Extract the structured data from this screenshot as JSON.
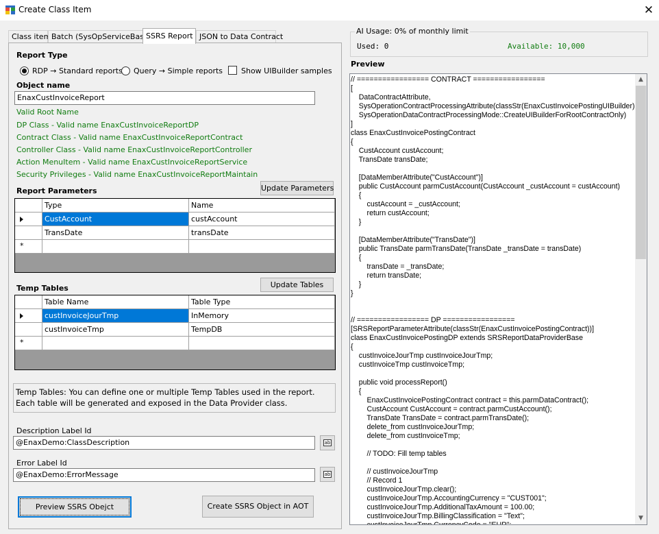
{
  "window": {
    "title": "Create Class Item",
    "close_symbol": "✕"
  },
  "tabs": [
    {
      "label": "Class item",
      "active": false
    },
    {
      "label": "Batch (SysOpServiceBase)",
      "active": false
    },
    {
      "label": "SSRS Report",
      "active": true
    },
    {
      "label": "JSON to Data Contract",
      "active": false
    }
  ],
  "report_type": {
    "heading": "Report Type",
    "options": [
      {
        "label": "RDP → Standard reports",
        "selected": true
      },
      {
        "label": "Query → Simple reports",
        "selected": false
      }
    ],
    "show_uibuilder_label": "Show UIBuilder samples",
    "show_uibuilder_checked": false
  },
  "object_name": {
    "heading": "Object name",
    "value": "EnaxCustInvoiceReport",
    "validation": [
      "Valid Root Name",
      "DP Class - Valid name EnaxCustInvoiceReportDP",
      "Contract Class - Valid name EnaxCustInvoiceReportContract",
      "Controller Class - Valid name EnaxCustInvoiceReportController",
      "Action MenuItem - Valid name EnaxCustInvoiceReportService",
      "Security Privileges - Valid name EnaxCustInvoiceReportMaintain"
    ]
  },
  "report_parameters": {
    "heading": "Report Parameters",
    "update_button": "Update Parameters",
    "columns": [
      "Type",
      "Name"
    ],
    "rows": [
      [
        "CustAccount",
        "custAccount"
      ],
      [
        "TransDate",
        "transDate"
      ]
    ],
    "new_row_marker": "*"
  },
  "temp_tables": {
    "heading": "Temp Tables",
    "update_button": "Update Tables",
    "columns": [
      "Table Name",
      "Table Type"
    ],
    "rows": [
      [
        "custInvoiceJourTmp",
        "InMemory"
      ],
      [
        "custInvoiceTmp",
        "TempDB"
      ]
    ],
    "new_row_marker": "*"
  },
  "info_text": "Temp Tables: You can define one or multiple Temp Tables used in the report. Each table will be generated and exposed in the Data Provider class.",
  "description_label": {
    "label": "Description Label Id",
    "value": "@EnaxDemo:ClassDescription"
  },
  "error_label": {
    "label": "Error Label Id",
    "value": "@EnaxDemo:ErrorMessage"
  },
  "actions": {
    "preview_button": "Preview SSRS Obejct",
    "create_button": "Create SSRS Object in AOT"
  },
  "ai_usage": {
    "title": "AI Usage: 0% of monthly limit",
    "used": "Used: 0",
    "available": "Available: 10,000",
    "available_color": "#107c10"
  },
  "preview": {
    "heading": "Preview",
    "code": "// ================= CONTRACT =================\n[\n    DataContractAttribute,\n    SysOperationContractProcessingAttribute(classStr(EnaxCustInvoicePostingUIBuilder),\n    SysOperationDataContractProcessingMode::CreateUIBuilderForRootContractOnly)\n]\nclass EnaxCustInvoicePostingContract\n{\n    CustAccount custAccount;\n    TransDate transDate;\n\n    [DataMemberAttribute(\"CustAccount\")]\n    public CustAccount parmCustAccount(CustAccount _custAccount = custAccount)\n    {\n        custAccount = _custAccount;\n        return custAccount;\n    }\n\n    [DataMemberAttribute(\"TransDate\")]\n    public TransDate parmTransDate(TransDate _transDate = transDate)\n    {\n        transDate = _transDate;\n        return transDate;\n    }\n}\n\n\n// ================= DP =================\n[SRSReportParameterAttribute(classStr(EnaxCustInvoicePostingContract))]\nclass EnaxCustInvoicePostingDP extends SRSReportDataProviderBase\n{\n    custInvoiceJourTmp custInvoiceJourTmp;\n    custInvoiceTmp custInvoiceTmp;\n\n    public void processReport()\n    {\n        EnaxCustInvoicePostingContract contract = this.parmDataContract();\n        CustAccount CustAccount = contract.parmCustAccount();\n        TransDate TransDate = contract.parmTransDate();\n        delete_from custInvoiceJourTmp;\n        delete_from custInvoiceTmp;\n\n        // TODO: Fill temp tables\n\n        // custInvoiceJourTmp\n        // Record 1\n        custInvoiceJourTmp.clear();\n        custInvoiceJourTmp.AccountingCurrency = \"CUST001\";\n        custInvoiceJourTmp.AdditionalTaxAmount = 100.00;\n        custInvoiceJourTmp.BillingClassification = \"Text\";\n        custInvoiceJourTmp.CurrencyCode = \"EUR\";"
  }
}
